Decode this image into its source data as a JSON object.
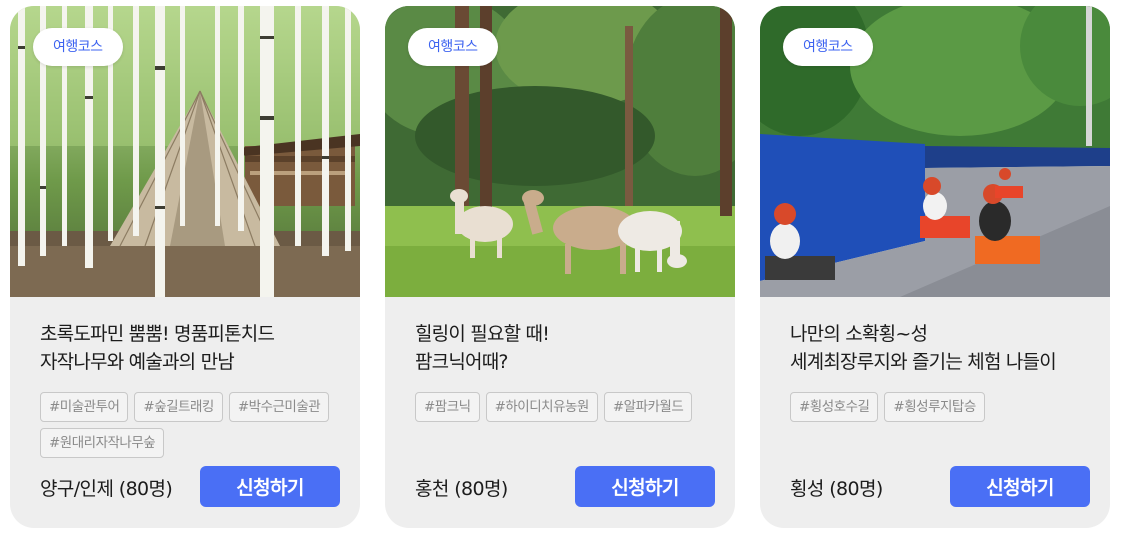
{
  "cards": [
    {
      "badge": "여행코스",
      "title_line1": "초록도파민 뿜뿜! 명품피톤치드",
      "title_line2": "자작나무와 예술과의 만남",
      "tags": [
        "#미술관투어",
        "#숲길트래킹",
        "#박수근미술관",
        "#원대리자작나무숲"
      ],
      "place": "양구/인제 (80명)",
      "button": "신청하기",
      "image": "birch-forest-with-teepee-and-cabin"
    },
    {
      "badge": "여행코스",
      "title_line1": "힐링이 필요할 때!",
      "title_line2": "팜크닉어때?",
      "tags": [
        "#팜크닉",
        "#하이디치유농원",
        "#알파카월드"
      ],
      "place": "홍천 (80명)",
      "button": "신청하기",
      "image": "alpacas-grazing-in-pine-forest"
    },
    {
      "badge": "여행코스",
      "title_line1": "나만의 소확횡~성",
      "title_line2": "세계최장루지와 즐기는 체험 나들이",
      "tags": [
        "#횡성호수길",
        "#횡성루지탑승"
      ],
      "place": "횡성 (80명)",
      "button": "신청하기",
      "image": "luge-carts-on-track"
    }
  ],
  "colors": {
    "accent": "#4a6ff5",
    "badge_text": "#3d63f0",
    "card_bg": "#eeeeee",
    "tag_text": "#8a8a8a"
  }
}
